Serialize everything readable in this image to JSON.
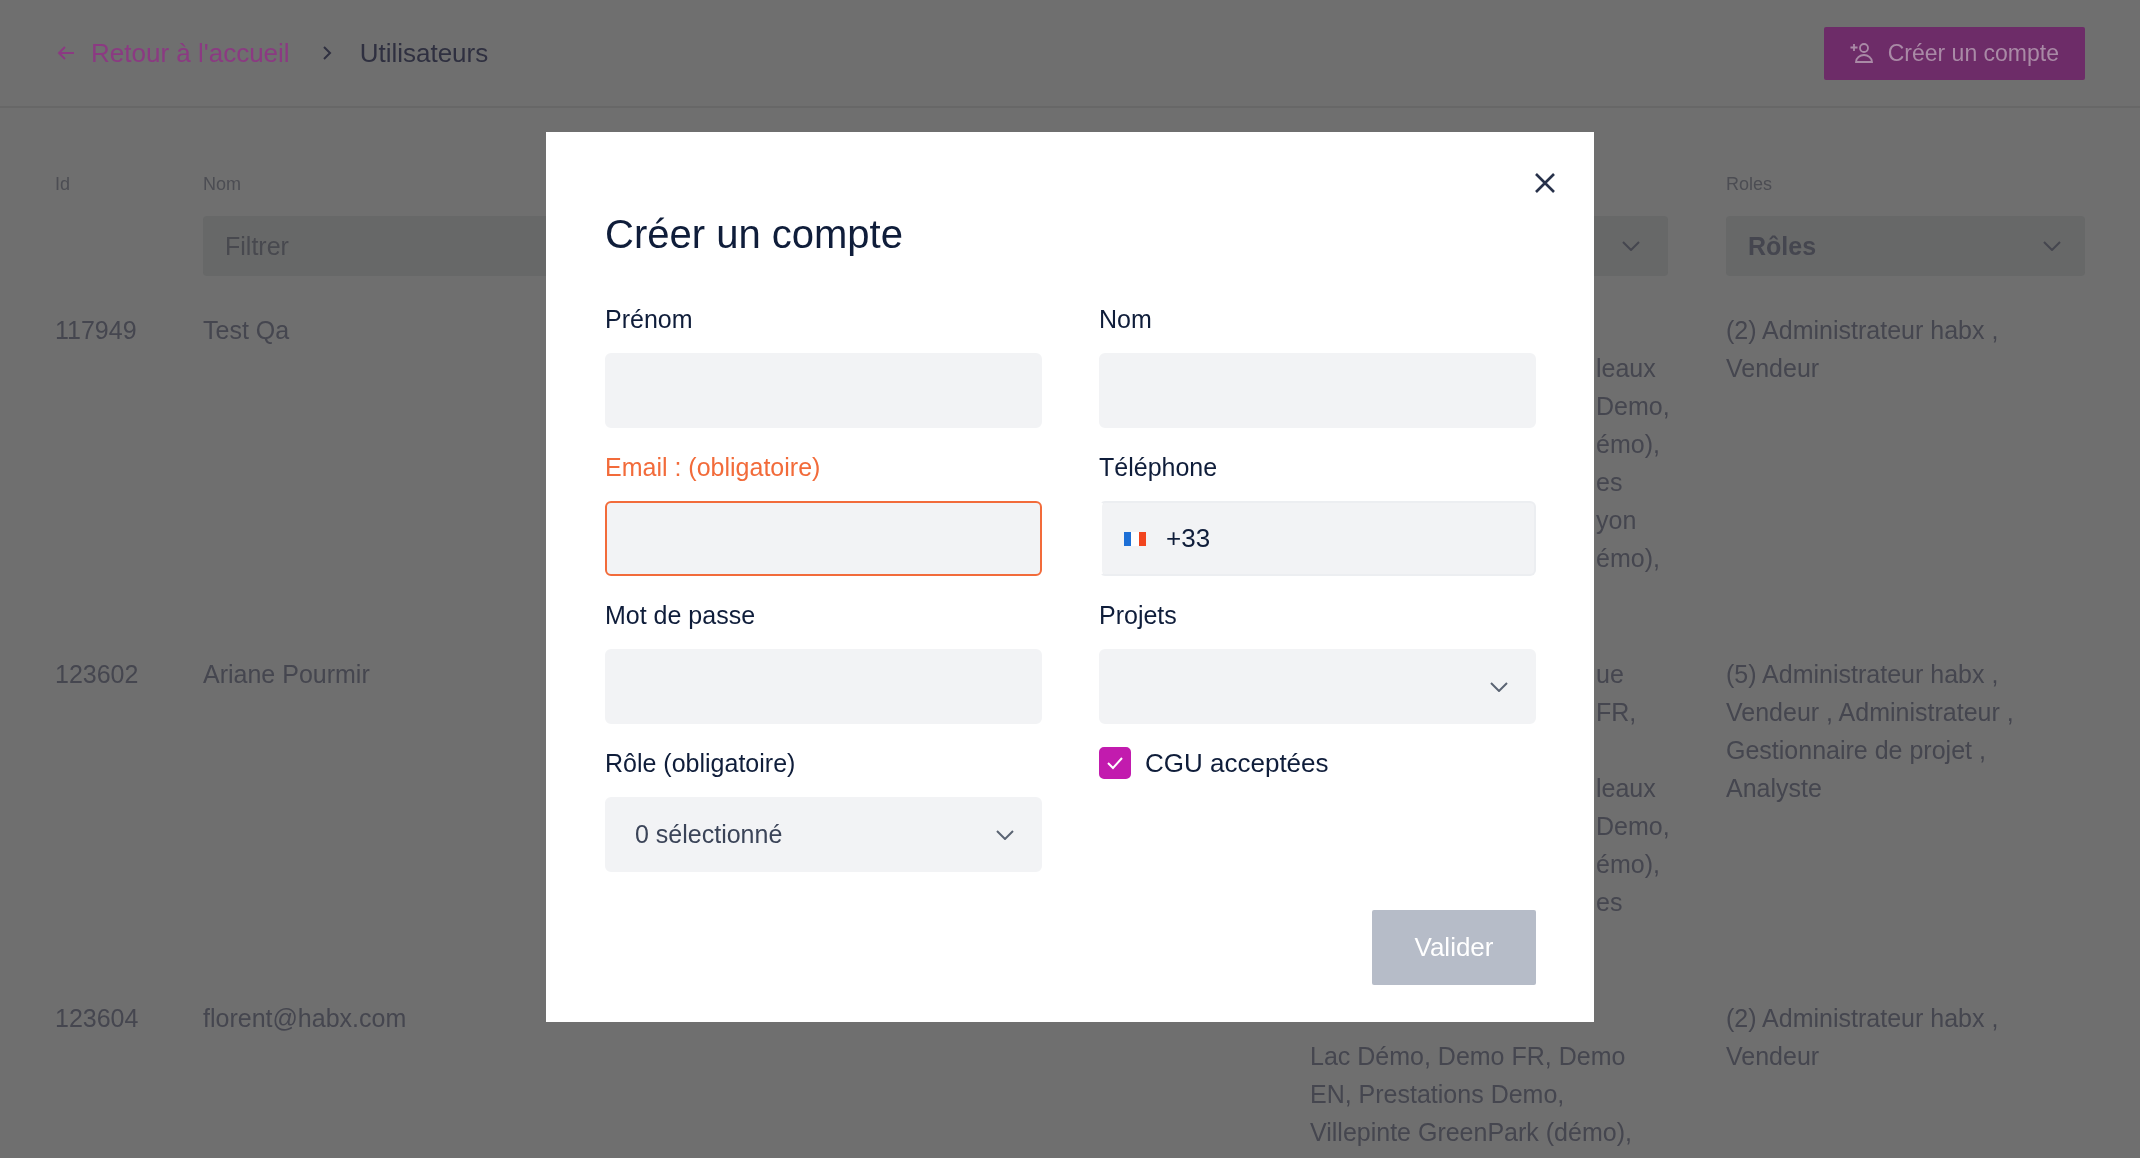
{
  "header": {
    "back_link": "Retour à l'accueil",
    "breadcrumb_current": "Utilisateurs",
    "create_button": "Créer un compte"
  },
  "table": {
    "columns": [
      {
        "kind": "id",
        "label": "Id"
      },
      {
        "kind": "name",
        "label": "Nom"
      },
      {
        "kind": "roles",
        "label": "Roles"
      }
    ],
    "name_filter": {
      "placeholder": "Filtrer"
    },
    "roles_filter": {
      "value": "Rôles"
    },
    "rows": [
      {
        "id": "117949",
        "name": "Test Qa",
        "projects": [
          {
            "kind": "fragment",
            "follows_hidden_line": true,
            "lines": [
              "leaux",
              "Demo,",
              "émo),",
              "es",
              "yon",
              "émo),"
            ]
          }
        ],
        "roles": "(2) Administrateur habx , Vendeur"
      },
      {
        "id": "123602",
        "name": "Ariane Pourmir",
        "projects": [
          {
            "kind": "fragment",
            "follows_hidden_line": false,
            "lines": [
              "ue",
              "FR,"
            ]
          },
          {
            "kind": "fragment",
            "follows_hidden_line": true,
            "lines": [
              "leaux",
              "Demo,",
              "émo),",
              "es"
            ]
          }
        ],
        "roles": "(5) Administrateur habx , Vendeur , Administrateur , Gestionnaire de projet , Analyste"
      },
      {
        "id": "123604",
        "name": "florent@habx.com",
        "projects": [
          {
            "kind": "full",
            "follows_hidden_line": true,
            "lines": [
              "Lac Démo, Demo FR, Demo",
              "EN, Prestations Demo,",
              "Villepinte GreenPark (démo),"
            ]
          }
        ],
        "roles": "(2) Administrateur habx , Vendeur"
      }
    ]
  },
  "modal": {
    "title": "Créer un compte",
    "fields": [
      {
        "kind": "text",
        "label": "Prénom",
        "invalid": false
      },
      {
        "kind": "text",
        "label": "Nom",
        "invalid": false
      },
      {
        "kind": "text",
        "label": "Email : (obligatoire)",
        "invalid": true
      },
      {
        "kind": "phone",
        "label": "Téléphone",
        "value": "+33",
        "invalid": false
      },
      {
        "kind": "password",
        "label": "Mot de passe",
        "invalid": false
      },
      {
        "kind": "select",
        "label": "Projets",
        "invalid": false
      },
      {
        "kind": "select",
        "label": "Rôle (obligatoire)",
        "value": "0 sélectionné",
        "invalid": false
      },
      {
        "kind": "checkbox",
        "label": "CGU acceptées",
        "checked": true
      }
    ],
    "submit": {
      "label": "Valider",
      "disabled": true
    }
  }
}
